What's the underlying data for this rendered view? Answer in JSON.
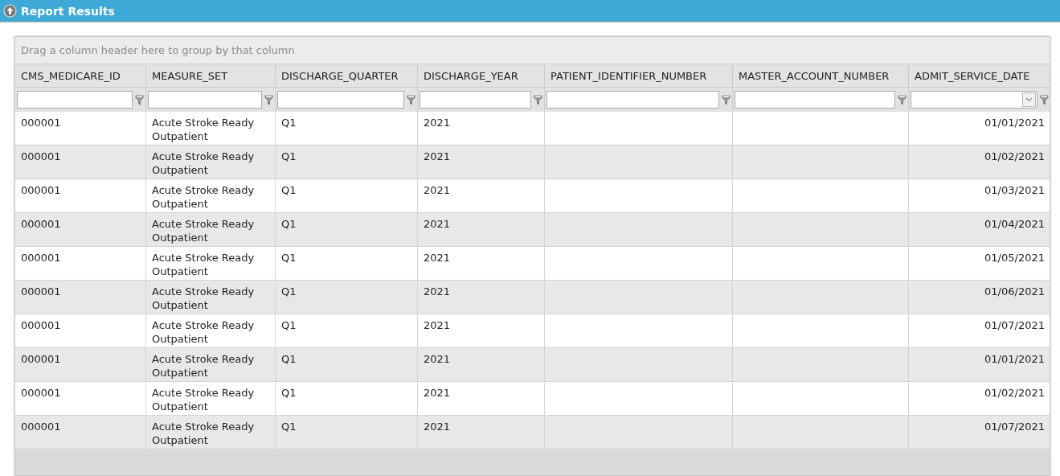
{
  "panel": {
    "title": "Report Results"
  },
  "grid": {
    "group_hint": "Drag a column header here to group by that column",
    "columns": [
      {
        "label": "CMS_MEDICARE_ID",
        "kind": "text"
      },
      {
        "label": "MEASURE_SET",
        "kind": "text"
      },
      {
        "label": "DISCHARGE_QUARTER",
        "kind": "text"
      },
      {
        "label": "DISCHARGE_YEAR",
        "kind": "text"
      },
      {
        "label": "PATIENT_IDENTIFIER_NUMBER",
        "kind": "text"
      },
      {
        "label": "MASTER_ACCOUNT_NUMBER",
        "kind": "text"
      },
      {
        "label": "ADMIT_SERVICE_DATE",
        "kind": "date"
      }
    ],
    "rows": [
      {
        "cells": [
          "000001",
          "Acute Stroke Ready Outpatient",
          "Q1",
          "2021",
          null,
          null,
          "01/01/2021"
        ]
      },
      {
        "cells": [
          "000001",
          "Acute Stroke Ready Outpatient",
          "Q1",
          "2021",
          null,
          null,
          "01/02/2021"
        ]
      },
      {
        "cells": [
          "000001",
          "Acute Stroke Ready Outpatient",
          "Q1",
          "2021",
          null,
          null,
          "01/03/2021"
        ]
      },
      {
        "cells": [
          "000001",
          "Acute Stroke Ready Outpatient",
          "Q1",
          "2021",
          null,
          null,
          "01/04/2021"
        ]
      },
      {
        "cells": [
          "000001",
          "Acute Stroke Ready Outpatient",
          "Q1",
          "2021",
          null,
          null,
          "01/05/2021"
        ]
      },
      {
        "cells": [
          "000001",
          "Acute Stroke Ready Outpatient",
          "Q1",
          "2021",
          null,
          null,
          "01/06/2021"
        ]
      },
      {
        "cells": [
          "000001",
          "Acute Stroke Ready Outpatient",
          "Q1",
          "2021",
          null,
          null,
          "01/07/2021"
        ]
      },
      {
        "cells": [
          "000001",
          "Acute Stroke Ready Outpatient",
          "Q1",
          "2021",
          null,
          null,
          "01/01/2021"
        ]
      },
      {
        "cells": [
          "000001",
          "Acute Stroke Ready Outpatient",
          "Q1",
          "2021",
          null,
          null,
          "01/02/2021"
        ]
      },
      {
        "cells": [
          "000001",
          "Acute Stroke Ready Outpatient",
          "Q1",
          "2021",
          null,
          null,
          "01/07/2021"
        ]
      }
    ]
  }
}
